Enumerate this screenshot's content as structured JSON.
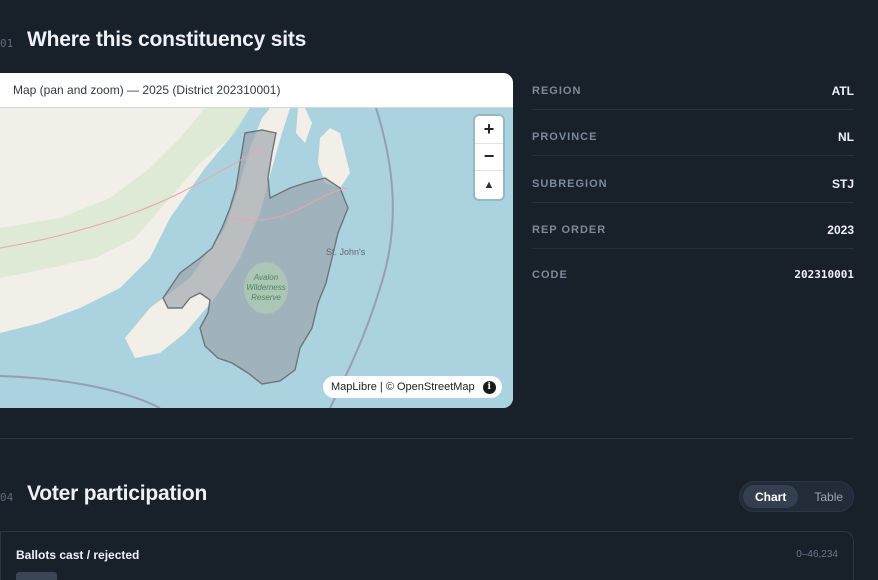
{
  "section1": {
    "num": "01",
    "title": "Where this constituency sits"
  },
  "map": {
    "header": "Map (pan and zoom) — 2025 (District 202310001)",
    "city_label": "St. John's",
    "park_label_lines": [
      "Avalon",
      "Wilderness",
      "Reserve"
    ],
    "zoom_in": "+",
    "zoom_out": "−",
    "compass": "▲",
    "attribution": "MapLibre | © OpenStreetMap",
    "info": "i",
    "colors": {
      "water": "#aad3df",
      "land": "#f2efe9",
      "district_fill": "#9aa0a6",
      "district_stroke": "#6f747a"
    }
  },
  "details": [
    {
      "key": "REGION",
      "value": "ATL"
    },
    {
      "key": "PROVINCE",
      "value": "NL"
    },
    {
      "key": "SUBREGION",
      "value": "STJ"
    },
    {
      "key": "REP ORDER",
      "value": "2023"
    },
    {
      "key": "CODE",
      "value": "202310001"
    }
  ],
  "section4": {
    "num": "04",
    "title": "Voter participation"
  },
  "toggle": {
    "chart": "Chart",
    "table": "Table",
    "active": "Chart"
  },
  "chart_card": {
    "title": "Ballots cast / rejected",
    "range": "0–46,234"
  },
  "chart_data": {
    "type": "bar",
    "title": "Ballots cast / rejected",
    "ylim": [
      0,
      46234
    ],
    "categories": [],
    "values": []
  }
}
